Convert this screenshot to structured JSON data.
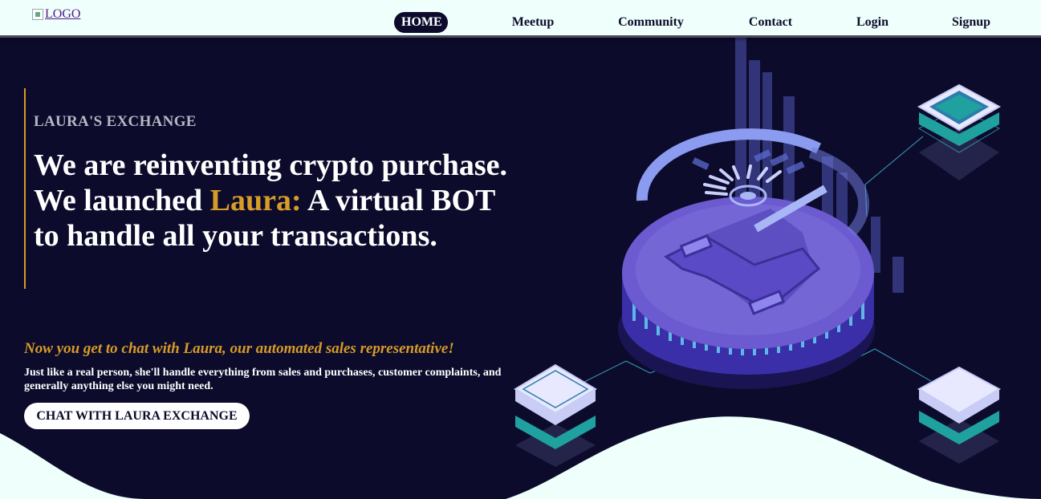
{
  "nav": {
    "logo_alt": "LOGO",
    "items": [
      {
        "label": "HOME",
        "active": true
      },
      {
        "label": "Meetup"
      },
      {
        "label": "Community"
      },
      {
        "label": "Contact"
      },
      {
        "label": "Login"
      },
      {
        "label": "Signup"
      }
    ]
  },
  "hero": {
    "brand": "LAURA'S EXCHANGE",
    "headline_line1": "We are reinventing crypto purchase.",
    "headline_line2_pre": "We launched ",
    "headline_highlight": "Laura:",
    "headline_line2_post": " A virtual BOT",
    "headline_line3": "to handle all your transactions.",
    "subtitle": "Now you get to chat with Laura, our automated sales representative!",
    "description": "Just like a real person, she'll handle everything from sales and purchases, customer complaints, and generally anything else you might need.",
    "cta_label": "CHAT WITH LAURA EXCHANGE"
  },
  "colors": {
    "background": "#0c0b2c",
    "nav_background": "#effffb",
    "accent": "#d79b27",
    "coin": "#6c5ad0"
  },
  "icons": [
    "broken-image-icon",
    "bitcoin-coin-illustration"
  ]
}
